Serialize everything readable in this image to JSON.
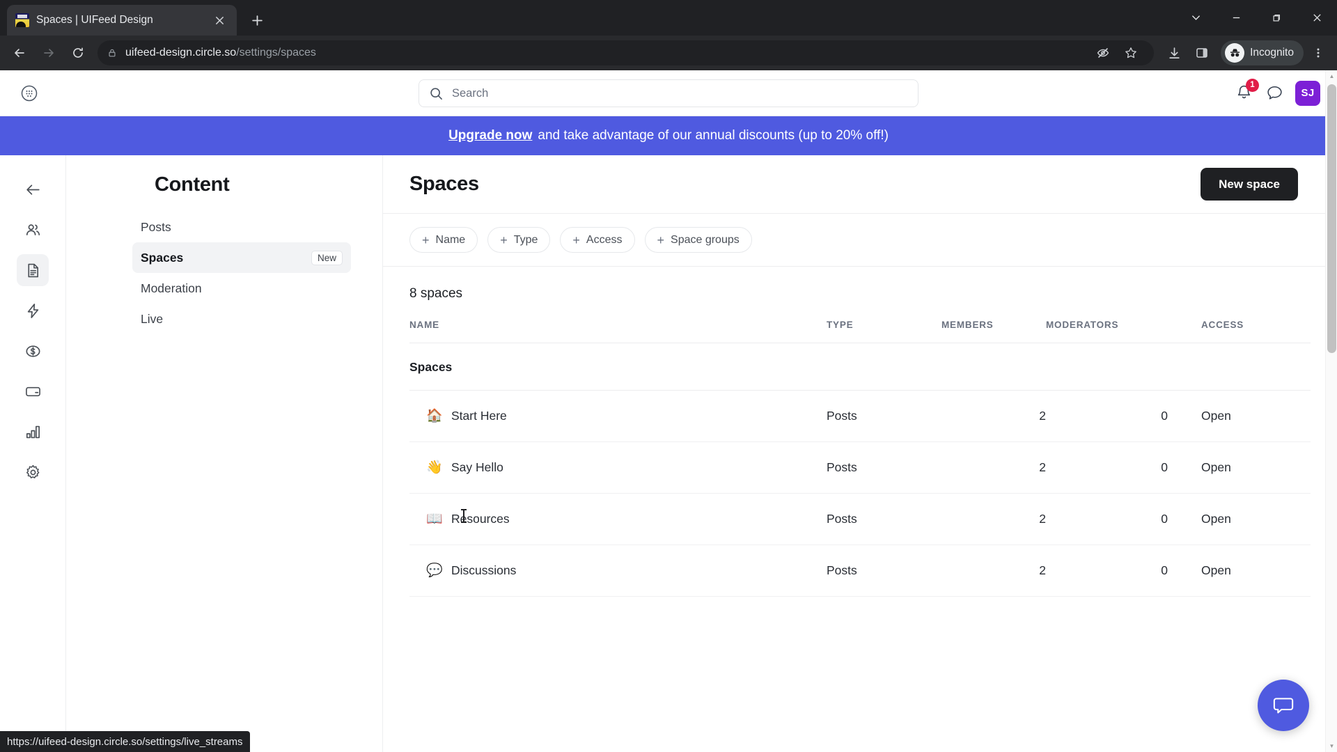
{
  "browser": {
    "tab": {
      "title": "Spaces | UIFeed Design",
      "favicon_name": "uifeed-favicon",
      "close_label": "×"
    },
    "new_tab_label": "+",
    "window_controls": {
      "tab_search": "⌄",
      "minimize": "—",
      "maximize": "□",
      "close": "×"
    },
    "nav": {
      "back": "←",
      "forward": "→",
      "reload": "⟳"
    },
    "omnibox": {
      "domain": "uifeed-design.circle.so",
      "path": "/settings/spaces",
      "lock_icon": "lock-icon"
    },
    "toolbar_icons": [
      "eye-off-icon",
      "star-icon",
      "download-icon",
      "side-panel-icon",
      "kebab-menu-icon"
    ],
    "profile": {
      "label": "Incognito",
      "icon": "incognito-icon"
    },
    "status_bar_url": "https://uifeed-design.circle.so/settings/live_streams"
  },
  "app": {
    "header": {
      "grid_icon": "app-grid-icon",
      "search": {
        "placeholder": "Search",
        "icon": "search-icon",
        "value": ""
      },
      "notifications": {
        "icon": "bell-icon",
        "count": "1"
      },
      "messages_icon": "chat-bubble-icon",
      "avatar_initials": "SJ",
      "avatar_color": "#7c20d6"
    },
    "banner": {
      "link_text": "Upgrade now",
      "rest_text": "and take advantage of our annual discounts (up to 20% off!)",
      "background": "#4f5ae0"
    },
    "icon_rail": [
      {
        "name": "back",
        "icon": "arrow-left-icon",
        "active": false
      },
      {
        "name": "members",
        "icon": "people-icon",
        "active": false
      },
      {
        "name": "content",
        "icon": "document-icon",
        "active": true
      },
      {
        "name": "workflows",
        "icon": "lightning-icon",
        "active": false
      },
      {
        "name": "monetization",
        "icon": "dollar-circle-icon",
        "active": false
      },
      {
        "name": "billing",
        "icon": "credit-card-icon",
        "active": false
      },
      {
        "name": "analytics",
        "icon": "bar-chart-icon",
        "active": false
      },
      {
        "name": "settings",
        "icon": "gear-icon",
        "active": false
      }
    ],
    "sidebar": {
      "title": "Content",
      "items": [
        {
          "label": "Posts",
          "badge": "",
          "active": false
        },
        {
          "label": "Spaces",
          "badge": "New",
          "active": true
        },
        {
          "label": "Moderation",
          "badge": "",
          "active": false
        },
        {
          "label": "Live",
          "badge": "",
          "active": false
        }
      ]
    },
    "main": {
      "title": "Spaces",
      "new_space_button": "New space",
      "filters": [
        {
          "label": "Name"
        },
        {
          "label": "Type"
        },
        {
          "label": "Access"
        },
        {
          "label": "Space groups"
        }
      ],
      "count_text": "8 spaces",
      "columns": {
        "name": "NAME",
        "type": "TYPE",
        "members": "MEMBERS",
        "moderators": "MODERATORS",
        "access": "ACCESS"
      },
      "group_label": "Spaces",
      "rows": [
        {
          "emoji": "🏠",
          "emoji_name": "house-emoji",
          "name": "Start Here",
          "type": "Posts",
          "members": "2",
          "moderators": "0",
          "access": "Open"
        },
        {
          "emoji": "👋",
          "emoji_name": "waving-hand-emoji",
          "name": "Say Hello",
          "type": "Posts",
          "members": "2",
          "moderators": "0",
          "access": "Open"
        },
        {
          "emoji": "📖",
          "emoji_name": "open-book-emoji",
          "name": "Resources",
          "type": "Posts",
          "members": "2",
          "moderators": "0",
          "access": "Open"
        },
        {
          "emoji": "💬",
          "emoji_name": "speech-balloon-emoji",
          "name": "Discussions",
          "type": "Posts",
          "members": "2",
          "moderators": "0",
          "access": "Open"
        }
      ]
    },
    "chat_fab": {
      "icon": "chat-bubble-icon",
      "color": "#4f5ae0"
    }
  }
}
